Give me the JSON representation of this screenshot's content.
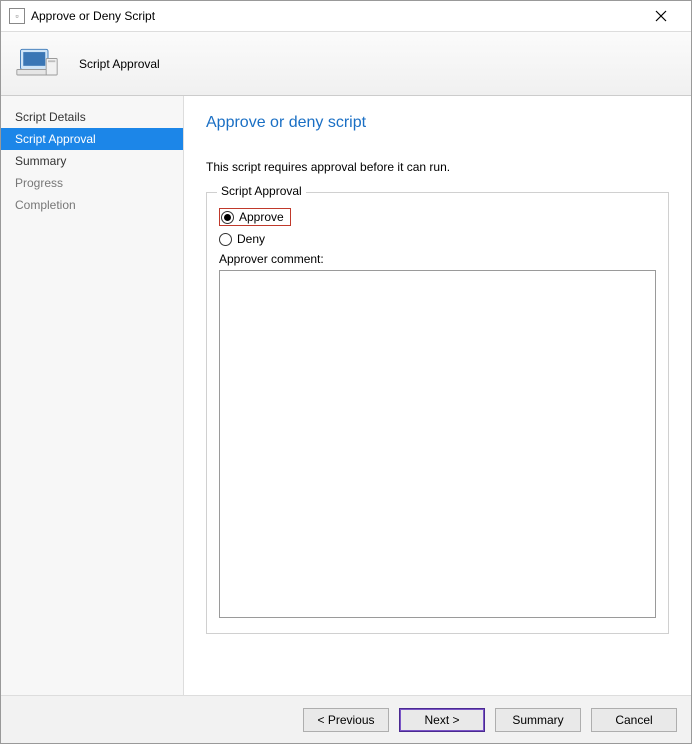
{
  "window": {
    "title": "Approve or Deny Script"
  },
  "header": {
    "title": "Script Approval"
  },
  "sidebar": {
    "items": [
      {
        "label": "Script Details",
        "active": false,
        "muted": false
      },
      {
        "label": "Script Approval",
        "active": true,
        "muted": false
      },
      {
        "label": "Summary",
        "active": false,
        "muted": false
      },
      {
        "label": "Progress",
        "active": false,
        "muted": true
      },
      {
        "label": "Completion",
        "active": false,
        "muted": true
      }
    ]
  },
  "page": {
    "title": "Approve or deny script",
    "subtext": "This script requires approval before it can run.",
    "group_legend": "Script Approval",
    "radio_approve": "Approve",
    "radio_deny": "Deny",
    "selected": "approve",
    "comment_label": "Approver comment:",
    "comment_value": ""
  },
  "footer": {
    "previous": "< Previous",
    "next": "Next >",
    "summary": "Summary",
    "cancel": "Cancel"
  }
}
